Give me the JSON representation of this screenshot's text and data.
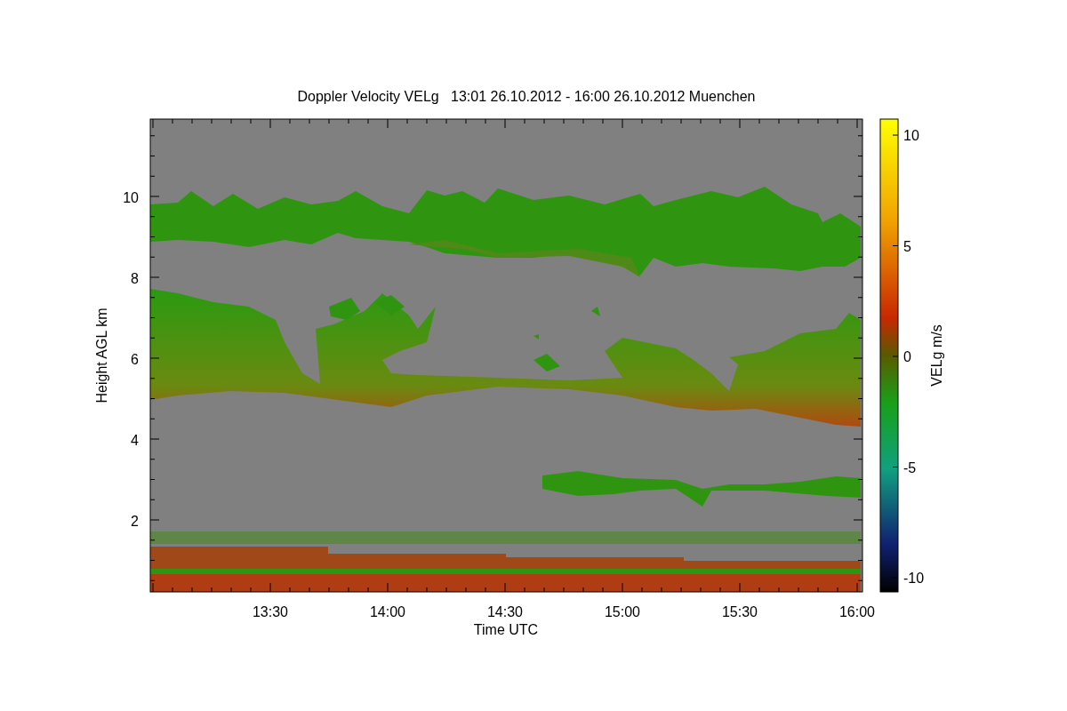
{
  "title": "Doppler Velocity VELg   13:01 26.10.2012 - 16:00 26.10.2012 Muenchen",
  "y_axis": {
    "label": "Height AGL km",
    "ticks": [
      "10",
      "8",
      "6",
      "4",
      "2"
    ]
  },
  "x_axis": {
    "label": "Time UTC",
    "ticks": [
      "13:30",
      "14:00",
      "14:30",
      "15:00",
      "15:30",
      "16:00"
    ]
  },
  "colorbar": {
    "label": "VELg m/s",
    "ticks": [
      "10",
      "5",
      "0",
      "-5",
      "-10"
    ]
  }
}
